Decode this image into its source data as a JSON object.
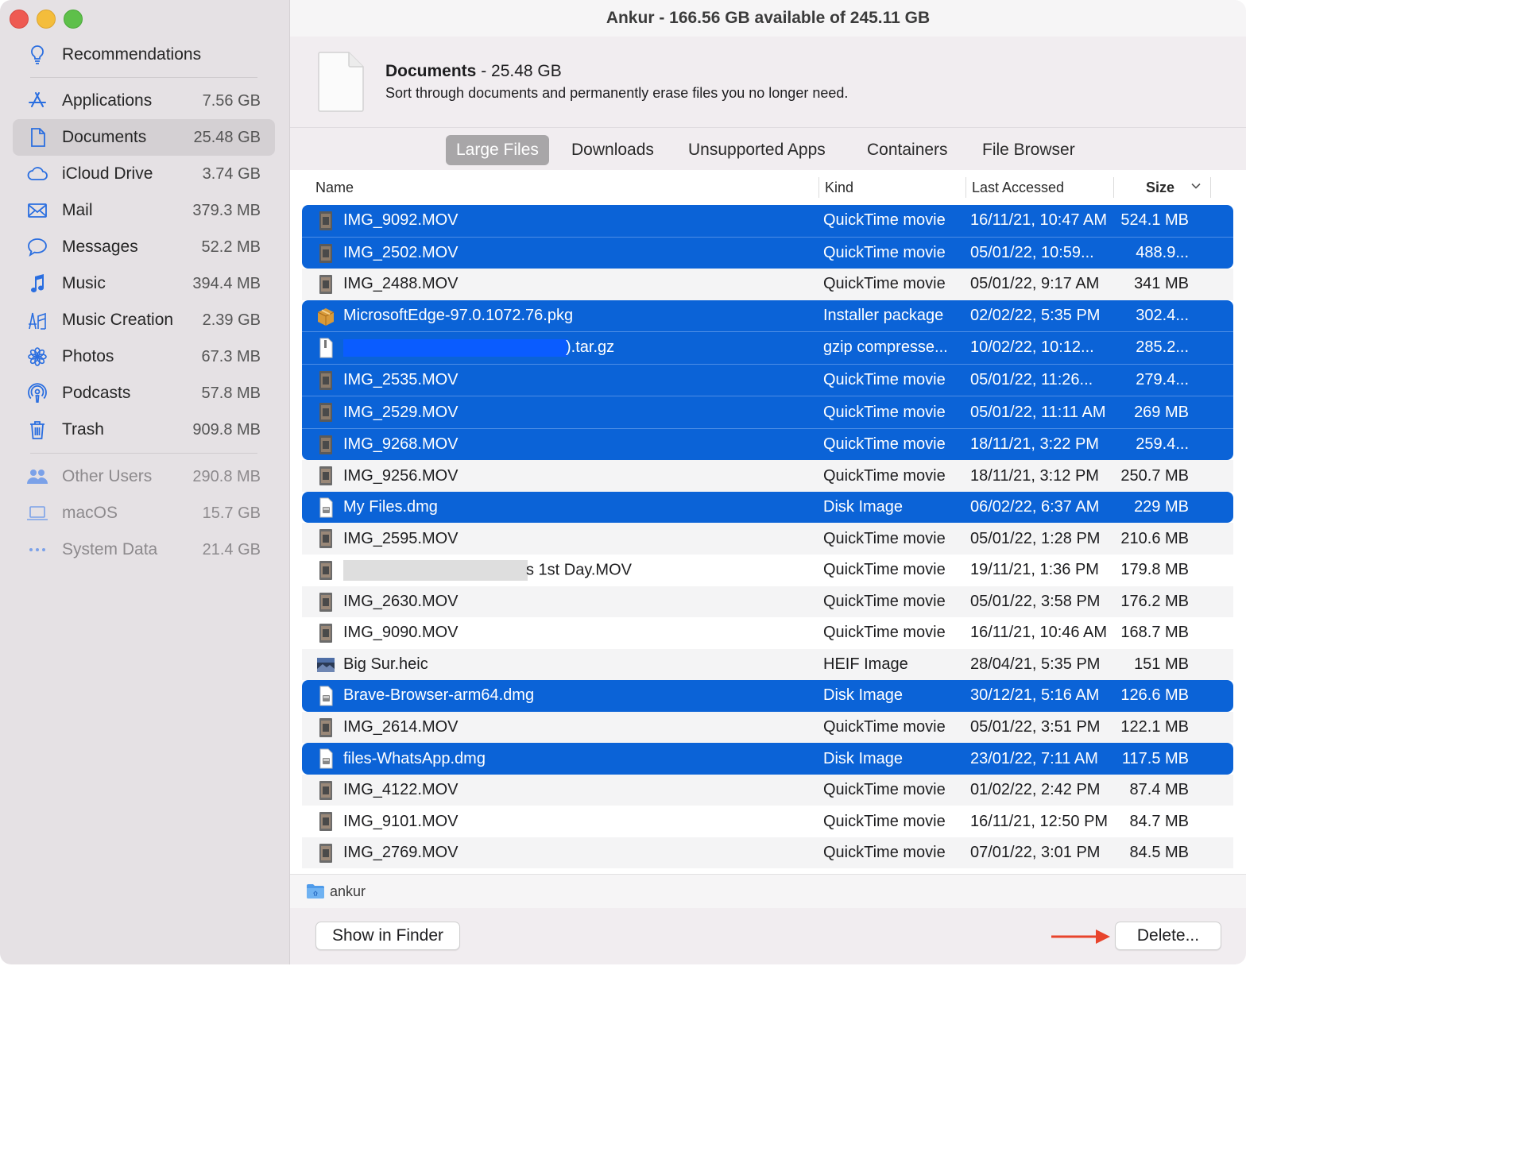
{
  "window": {
    "title": "Ankur - 166.56 GB available of 245.11 GB"
  },
  "sidebar": {
    "recommendations": {
      "label": "Recommendations",
      "icon": "lightbulb-icon"
    },
    "items": [
      {
        "label": "Applications",
        "size": "7.56 GB",
        "icon": "app-store-icon"
      },
      {
        "label": "Documents",
        "size": "25.48 GB",
        "icon": "document-icon",
        "active": true
      },
      {
        "label": "iCloud Drive",
        "size": "3.74 GB",
        "icon": "cloud-icon"
      },
      {
        "label": "Mail",
        "size": "379.3 MB",
        "icon": "envelope-icon"
      },
      {
        "label": "Messages",
        "size": "52.2 MB",
        "icon": "message-bubble-icon"
      },
      {
        "label": "Music",
        "size": "394.4 MB",
        "icon": "music-note-icon"
      },
      {
        "label": "Music Creation",
        "size": "2.39 GB",
        "icon": "music-creation-icon"
      },
      {
        "label": "Photos",
        "size": "67.3 MB",
        "icon": "photos-flower-icon"
      },
      {
        "label": "Podcasts",
        "size": "57.8 MB",
        "icon": "podcast-icon"
      },
      {
        "label": "Trash",
        "size": "909.8 MB",
        "icon": "trash-icon"
      }
    ],
    "other": [
      {
        "label": "Other Users",
        "size": "290.8 MB",
        "icon": "users-icon"
      },
      {
        "label": "macOS",
        "size": "15.7 GB",
        "icon": "laptop-icon"
      },
      {
        "label": "System Data",
        "size": "21.4 GB",
        "icon": "ellipsis-icon"
      }
    ]
  },
  "header": {
    "title": "Documents",
    "size": " - 25.48 GB",
    "subtitle": "Sort through documents and permanently erase files you no longer need."
  },
  "tabs": [
    {
      "label": "Large Files",
      "active": true
    },
    {
      "label": "Downloads"
    },
    {
      "label": "Unsupported Apps"
    },
    {
      "label": "Containers"
    },
    {
      "label": "File Browser"
    }
  ],
  "table": {
    "columns": {
      "name": "Name",
      "kind": "Kind",
      "last_accessed": "Last Accessed",
      "size": "Size"
    },
    "rows": [
      {
        "name": "IMG_9092.MOV",
        "kind": "QuickTime movie",
        "date": "16/11/21, 10:47 AM",
        "size": "524.1 MB",
        "selected": true,
        "icon": "movie-thumbnail-icon"
      },
      {
        "name": "IMG_2502.MOV",
        "kind": "QuickTime movie",
        "date": "05/01/22, 10:59...",
        "size": "488.9...",
        "selected": true,
        "icon": "movie-thumbnail-icon"
      },
      {
        "name": "IMG_2488.MOV",
        "kind": "QuickTime movie",
        "date": "05/01/22, 9:17 AM",
        "size": "341 MB",
        "selected": false,
        "icon": "movie-thumbnail-icon"
      },
      {
        "name": "MicrosoftEdge-97.0.1072.76.pkg",
        "kind": "Installer package",
        "date": "02/02/22, 5:35 PM",
        "size": "302.4...",
        "selected": true,
        "icon": "package-icon"
      },
      {
        "name": ").tar.gz",
        "kind": "gzip compresse...",
        "date": "10/02/22, 10:12...",
        "size": "285.2...",
        "selected": true,
        "icon": "archive-icon",
        "redact": "blue"
      },
      {
        "name": "IMG_2535.MOV",
        "kind": "QuickTime movie",
        "date": "05/01/22, 11:26...",
        "size": "279.4...",
        "selected": true,
        "icon": "movie-thumbnail-icon"
      },
      {
        "name": "IMG_2529.MOV",
        "kind": "QuickTime movie",
        "date": "05/01/22, 11:11 AM",
        "size": "269 MB",
        "selected": true,
        "icon": "movie-thumbnail-icon"
      },
      {
        "name": "IMG_9268.MOV",
        "kind": "QuickTime movie",
        "date": "18/11/21, 3:22 PM",
        "size": "259.4...",
        "selected": true,
        "icon": "movie-thumbnail-icon"
      },
      {
        "name": "IMG_9256.MOV",
        "kind": "QuickTime movie",
        "date": "18/11/21, 3:12 PM",
        "size": "250.7 MB",
        "selected": false,
        "icon": "movie-thumbnail-icon"
      },
      {
        "name": "My Files.dmg",
        "kind": "Disk Image",
        "date": "06/02/22, 6:37 AM",
        "size": "229 MB",
        "selected": true,
        "icon": "disk-image-icon"
      },
      {
        "name": "IMG_2595.MOV",
        "kind": "QuickTime movie",
        "date": "05/01/22, 1:28 PM",
        "size": "210.6 MB",
        "selected": false,
        "icon": "movie-thumbnail-icon"
      },
      {
        "name": "s 1st Day.MOV",
        "kind": "QuickTime movie",
        "date": "19/11/21, 1:36 PM",
        "size": "179.8 MB",
        "selected": false,
        "icon": "movie-thumbnail-icon",
        "redact": "gray"
      },
      {
        "name": "IMG_2630.MOV",
        "kind": "QuickTime movie",
        "date": "05/01/22, 3:58 PM",
        "size": "176.2 MB",
        "selected": false,
        "icon": "movie-thumbnail-icon"
      },
      {
        "name": "IMG_9090.MOV",
        "kind": "QuickTime movie",
        "date": "16/11/21, 10:46 AM",
        "size": "168.7 MB",
        "selected": false,
        "icon": "movie-thumbnail-icon"
      },
      {
        "name": "Big Sur.heic",
        "kind": "HEIF Image",
        "date": "28/04/21, 5:35 PM",
        "size": "151 MB",
        "selected": false,
        "icon": "image-thumbnail-icon"
      },
      {
        "name": "Brave-Browser-arm64.dmg",
        "kind": "Disk Image",
        "date": "30/12/21, 5:16 AM",
        "size": "126.6 MB",
        "selected": true,
        "icon": "disk-image-icon"
      },
      {
        "name": "IMG_2614.MOV",
        "kind": "QuickTime movie",
        "date": "05/01/22, 3:51 PM",
        "size": "122.1 MB",
        "selected": false,
        "icon": "movie-thumbnail-icon"
      },
      {
        "name": "files-WhatsApp.dmg",
        "kind": "Disk Image",
        "date": "23/01/22, 7:11 AM",
        "size": "117.5 MB",
        "selected": true,
        "icon": "disk-image-icon"
      },
      {
        "name": "IMG_4122.MOV",
        "kind": "QuickTime movie",
        "date": "01/02/22, 2:42 PM",
        "size": "87.4 MB",
        "selected": false,
        "icon": "movie-thumbnail-icon"
      },
      {
        "name": "IMG_9101.MOV",
        "kind": "QuickTime movie",
        "date": "16/11/21, 12:50 PM",
        "size": "84.7 MB",
        "selected": false,
        "icon": "movie-thumbnail-icon"
      },
      {
        "name": "IMG_2769.MOV",
        "kind": "QuickTime movie",
        "date": "07/01/22, 3:01 PM",
        "size": "84.5 MB",
        "selected": false,
        "icon": "movie-thumbnail-icon"
      }
    ]
  },
  "path_bar": {
    "label": "ankur",
    "icon": "folder-icon"
  },
  "footer": {
    "show_in_finder": "Show in Finder",
    "delete": "Delete..."
  },
  "colors": {
    "selection": "#0b63d7",
    "accent": "#2a6ee0",
    "arrow": "#e8442c"
  }
}
